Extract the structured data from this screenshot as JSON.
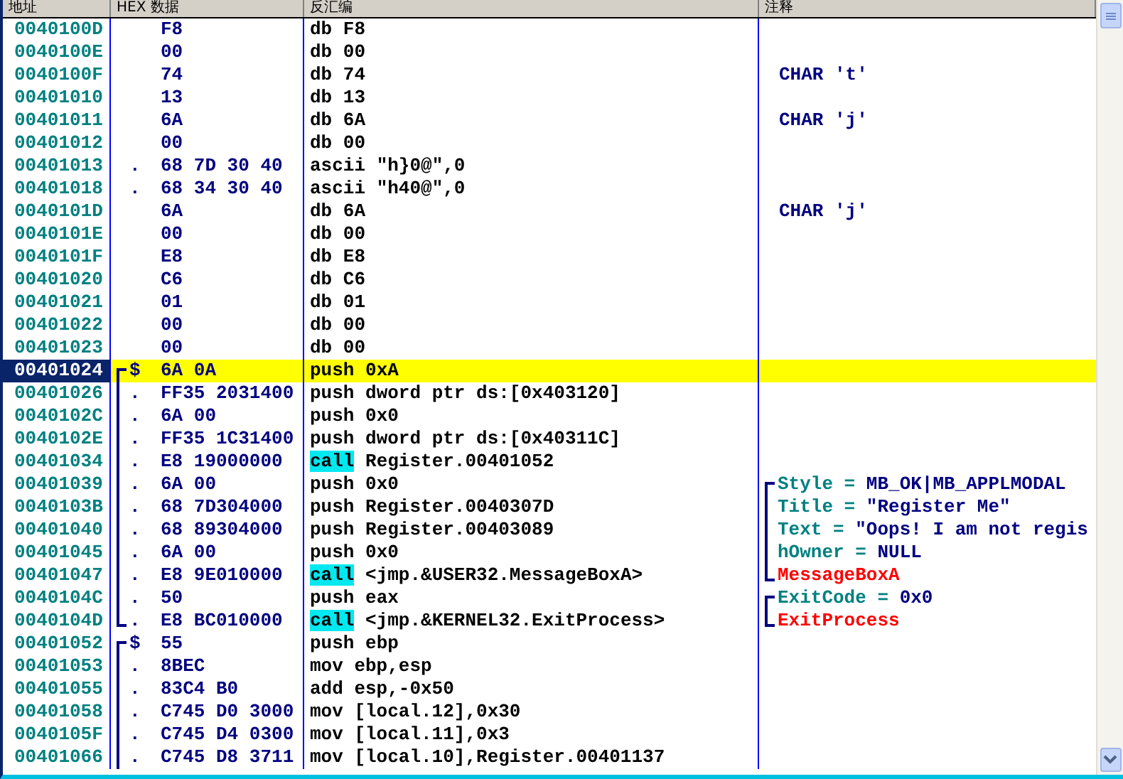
{
  "columns": [
    "地址",
    "HEX 数据",
    "反汇编",
    "注释"
  ],
  "rows": [
    {
      "address": "0040100D",
      "in_block": false,
      "hex": "F8",
      "mnemonic": "db",
      "operands": "F8",
      "call": false,
      "selected": false
    },
    {
      "address": "0040100E",
      "in_block": false,
      "hex": "00",
      "mnemonic": "db",
      "operands": "00",
      "call": false,
      "selected": false
    },
    {
      "address": "0040100F",
      "in_block": false,
      "hex": "74",
      "mnemonic": "db",
      "operands": "74",
      "call": false,
      "selected": false,
      "comment": {
        "kind": "char",
        "text": "CHAR 't'",
        "in_block": false
      }
    },
    {
      "address": "00401010",
      "in_block": false,
      "hex": "13",
      "mnemonic": "db",
      "operands": "13",
      "call": false,
      "selected": false
    },
    {
      "address": "00401011",
      "in_block": false,
      "hex": "6A",
      "mnemonic": "db",
      "operands": "6A",
      "call": false,
      "selected": false,
      "comment": {
        "kind": "char",
        "text": "CHAR 'j'",
        "in_block": false
      }
    },
    {
      "address": "00401012",
      "in_block": false,
      "hex": "00",
      "mnemonic": "db",
      "operands": "00",
      "call": false,
      "selected": false
    },
    {
      "address": "00401013",
      "marker": ".",
      "in_block": false,
      "hex": "68 7D 30 40",
      "mnemonic": "ascii",
      "operands": "\"h}0@\",0",
      "call": false,
      "selected": false
    },
    {
      "address": "00401018",
      "marker": ".",
      "in_block": false,
      "hex": "68 34 30 40",
      "mnemonic": "ascii",
      "operands": "\"h40@\",0",
      "call": false,
      "selected": false
    },
    {
      "address": "0040101D",
      "in_block": false,
      "hex": "6A",
      "mnemonic": "db",
      "operands": "6A",
      "call": false,
      "selected": false,
      "comment": {
        "kind": "char",
        "text": "CHAR 'j'",
        "in_block": false
      }
    },
    {
      "address": "0040101E",
      "in_block": false,
      "hex": "00",
      "mnemonic": "db",
      "operands": "00",
      "call": false,
      "selected": false
    },
    {
      "address": "0040101F",
      "in_block": false,
      "hex": "E8",
      "mnemonic": "db",
      "operands": "E8",
      "call": false,
      "selected": false
    },
    {
      "address": "00401020",
      "in_block": false,
      "hex": "C6",
      "mnemonic": "db",
      "operands": "C6",
      "call": false,
      "selected": false
    },
    {
      "address": "00401021",
      "in_block": false,
      "hex": "01",
      "mnemonic": "db",
      "operands": "01",
      "call": false,
      "selected": false
    },
    {
      "address": "00401022",
      "in_block": false,
      "hex": "00",
      "mnemonic": "db",
      "operands": "00",
      "call": false,
      "selected": false
    },
    {
      "address": "00401023",
      "in_block": false,
      "hex": "00",
      "mnemonic": "db",
      "operands": "00",
      "call": false,
      "selected": false
    },
    {
      "address": "00401024",
      "marker": "$",
      "in_block": true,
      "block_start": true,
      "block_end": false,
      "hex": "6A 0A",
      "mnemonic": "push",
      "operands": "0xA",
      "call": false,
      "selected": true
    },
    {
      "address": "00401026",
      "marker": ".",
      "in_block": true,
      "block_start": false,
      "block_end": false,
      "hex": "FF35 2031400",
      "mnemonic": "push",
      "operands": "dword ptr ds:[0x403120]",
      "call": false,
      "selected": false
    },
    {
      "address": "0040102C",
      "marker": ".",
      "in_block": true,
      "block_start": false,
      "block_end": false,
      "hex": "6A 00",
      "mnemonic": "push",
      "operands": "0x0",
      "call": false,
      "selected": false
    },
    {
      "address": "0040102E",
      "marker": ".",
      "in_block": true,
      "block_start": false,
      "block_end": false,
      "hex": "FF35 1C31400",
      "mnemonic": "push",
      "operands": "dword ptr ds:[0x40311C]",
      "call": false,
      "selected": false
    },
    {
      "address": "00401034",
      "marker": ".",
      "in_block": true,
      "block_start": false,
      "block_end": false,
      "hex": "E8 19000000",
      "mnemonic": "call",
      "operands": "Register.00401052",
      "call": true,
      "selected": false
    },
    {
      "address": "00401039",
      "marker": ".",
      "in_block": true,
      "block_start": false,
      "block_end": false,
      "hex": "6A 00",
      "mnemonic": "push",
      "operands": "0x0",
      "call": false,
      "selected": false,
      "comment": {
        "kind": "arg",
        "in_block": true,
        "block_start": true,
        "block_end": false,
        "name": "Style =",
        "value": "MB_OK|MB_APPLMODAL"
      }
    },
    {
      "address": "0040103B",
      "marker": ".",
      "in_block": true,
      "block_start": false,
      "block_end": false,
      "hex": "68 7D304000",
      "mnemonic": "push",
      "operands": "Register.0040307D",
      "call": false,
      "selected": false,
      "comment": {
        "kind": "arg",
        "in_block": true,
        "block_start": false,
        "block_end": false,
        "name": "Title =",
        "value": "\"Register Me\""
      }
    },
    {
      "address": "00401040",
      "marker": ".",
      "in_block": true,
      "block_start": false,
      "block_end": false,
      "hex": "68 89304000",
      "mnemonic": "push",
      "operands": "Register.00403089",
      "call": false,
      "selected": false,
      "comment": {
        "kind": "arg",
        "in_block": true,
        "block_start": false,
        "block_end": false,
        "name": "Text =",
        "value": "\"Oops! I am not regis"
      }
    },
    {
      "address": "00401045",
      "marker": ".",
      "in_block": true,
      "block_start": false,
      "block_end": false,
      "hex": "6A 00",
      "mnemonic": "push",
      "operands": "0x0",
      "call": false,
      "selected": false,
      "comment": {
        "kind": "arg",
        "in_block": true,
        "block_start": false,
        "block_end": false,
        "name": "hOwner =",
        "value": "NULL"
      }
    },
    {
      "address": "00401047",
      "marker": ".",
      "in_block": true,
      "block_start": false,
      "block_end": false,
      "hex": "E8 9E010000",
      "mnemonic": "call",
      "operands": "<jmp.&USER32.MessageBoxA>",
      "call": true,
      "selected": false,
      "comment": {
        "kind": "api",
        "in_block": true,
        "block_start": false,
        "block_end": true,
        "text": "MessageBoxA"
      }
    },
    {
      "address": "0040104C",
      "marker": ".",
      "in_block": true,
      "block_start": false,
      "block_end": false,
      "hex": "50",
      "mnemonic": "push",
      "operands": "eax",
      "call": false,
      "selected": false,
      "comment": {
        "kind": "arg",
        "in_block": true,
        "block_start": true,
        "block_end": false,
        "name": "ExitCode =",
        "value": "0x0"
      }
    },
    {
      "address": "0040104D",
      "marker": ".",
      "in_block": true,
      "block_start": false,
      "block_end": true,
      "hex": "E8 BC010000",
      "mnemonic": "call",
      "operands": "<jmp.&KERNEL32.ExitProcess>",
      "call": true,
      "selected": false,
      "comment": {
        "kind": "api",
        "in_block": true,
        "block_start": false,
        "block_end": true,
        "text": "ExitProcess"
      }
    },
    {
      "address": "00401052",
      "marker": "$",
      "in_block": true,
      "block_start": true,
      "block_end": false,
      "hex": "55",
      "mnemonic": "push",
      "operands": "ebp",
      "call": false,
      "selected": false
    },
    {
      "address": "00401053",
      "marker": ".",
      "in_block": true,
      "block_start": false,
      "block_end": false,
      "hex": "8BEC",
      "mnemonic": "mov",
      "operands": "ebp,esp",
      "call": false,
      "selected": false
    },
    {
      "address": "00401055",
      "marker": ".",
      "in_block": true,
      "block_start": false,
      "block_end": false,
      "hex": "83C4 B0",
      "mnemonic": "add",
      "operands": "esp,-0x50",
      "call": false,
      "selected": false
    },
    {
      "address": "00401058",
      "marker": ".",
      "in_block": true,
      "block_start": false,
      "block_end": false,
      "hex": "C745 D0 3000",
      "mnemonic": "mov",
      "operands": "[local.12],0x30",
      "call": false,
      "selected": false
    },
    {
      "address": "0040105F",
      "marker": ".",
      "in_block": true,
      "block_start": false,
      "block_end": false,
      "hex": "C745 D4 0300",
      "mnemonic": "mov",
      "operands": "[local.11],0x3",
      "call": false,
      "selected": false
    },
    {
      "address": "00401066",
      "marker": ".",
      "in_block": true,
      "block_start": false,
      "block_end": false,
      "hex": "C745 D8 3711",
      "mnemonic": "mov",
      "operands": "[local.10],Register.00401137",
      "call": false,
      "selected": false
    }
  ]
}
